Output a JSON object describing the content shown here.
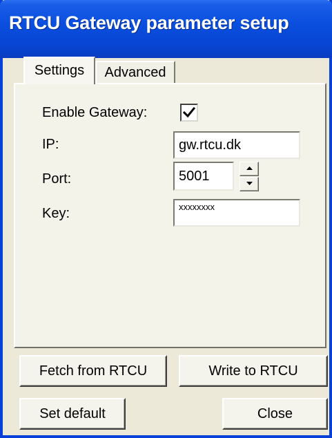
{
  "window": {
    "title": "RTCU Gateway parameter setup"
  },
  "tabs": [
    {
      "label": "Settings",
      "active": true
    },
    {
      "label": "Advanced",
      "active": false
    }
  ],
  "settings": {
    "enable_gateway": {
      "label": "Enable Gateway:",
      "checked": true
    },
    "ip": {
      "label": "IP:",
      "value": "gw.rtcu.dk"
    },
    "port": {
      "label": "Port:",
      "value": "5001"
    },
    "key": {
      "label": "Key:",
      "value": "xxxxxxxx"
    }
  },
  "buttons": {
    "fetch": "Fetch from RTCU",
    "write": "Write to RTCU",
    "set_default": "Set default",
    "close": "Close"
  },
  "icons": {
    "checkmark": "checkmark-icon",
    "spin_up": "arrow-up-icon",
    "spin_down": "arrow-down-icon"
  },
  "colors": {
    "titlebar": "#0a4fdf",
    "window_bg": "#ece9d8",
    "panel_bg": "#f4f3ea"
  }
}
